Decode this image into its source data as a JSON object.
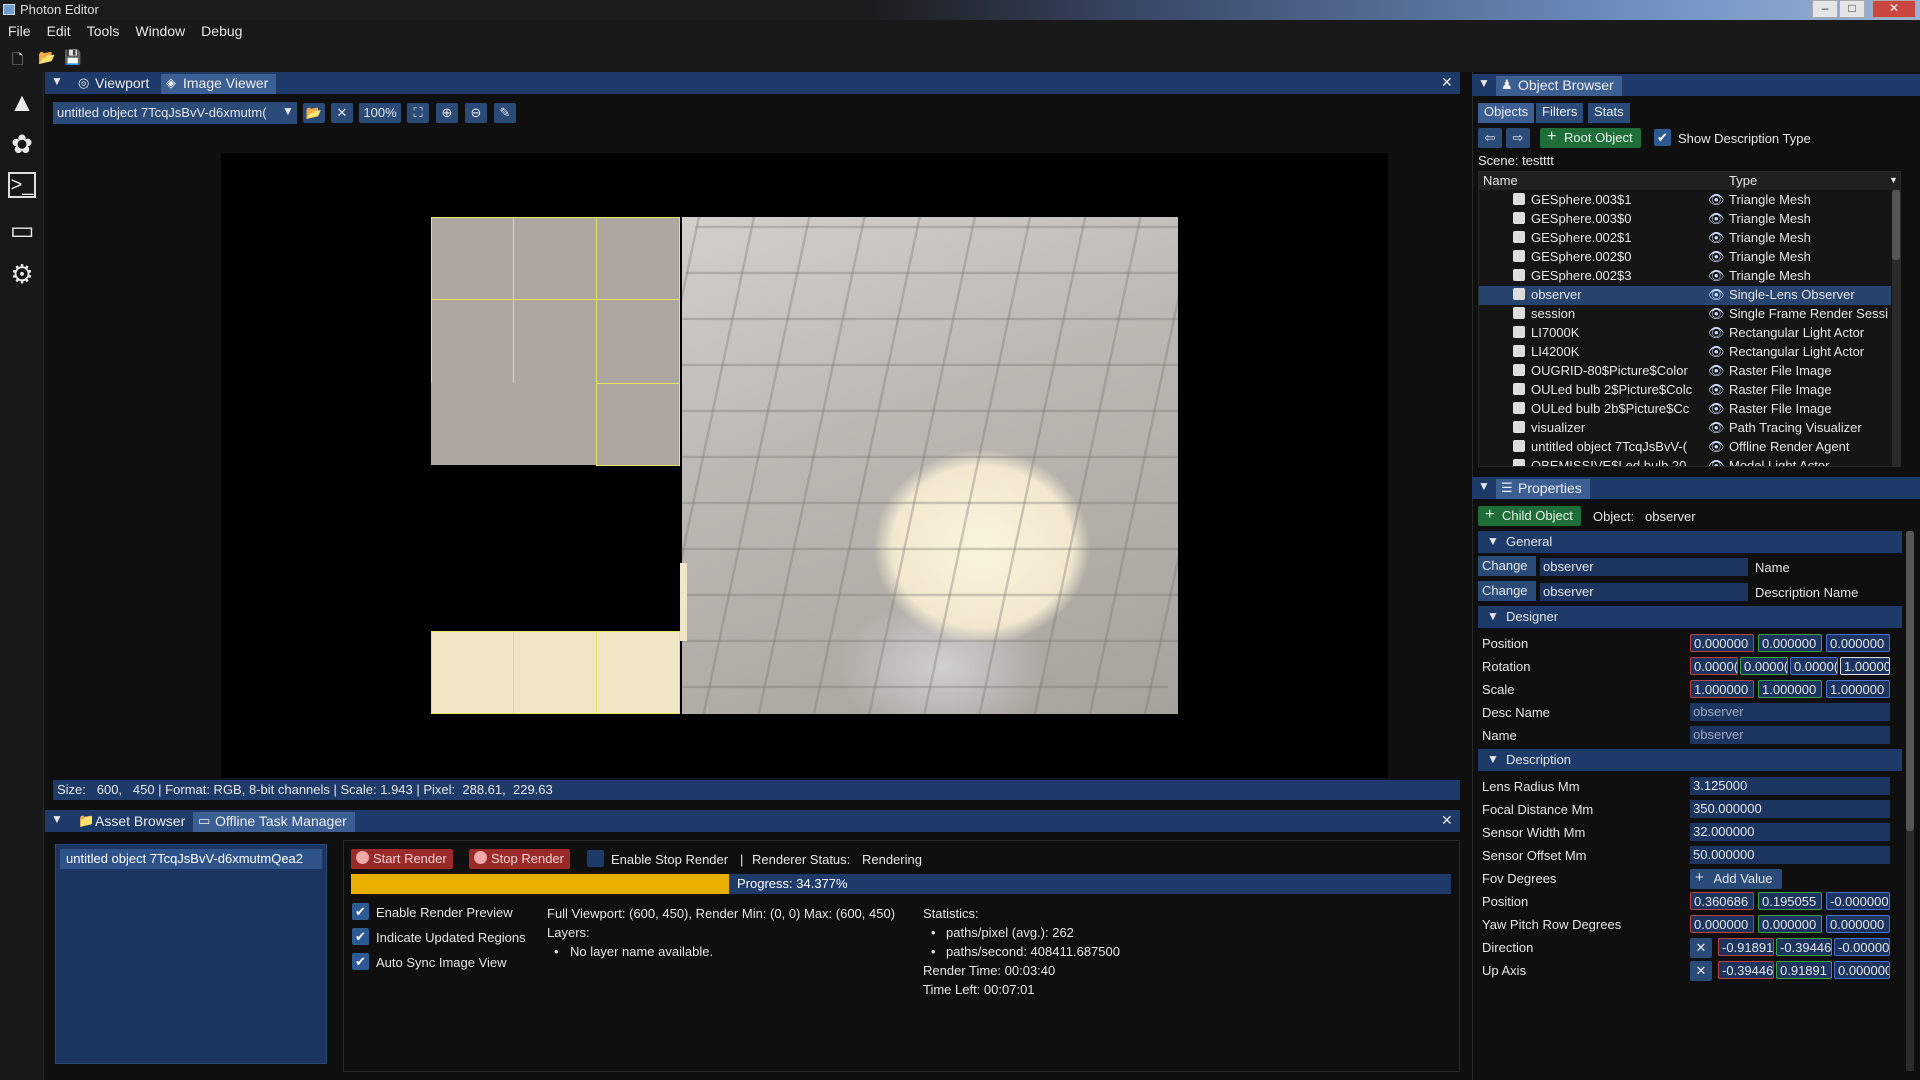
{
  "window": {
    "title": "Photon Editor",
    "minimize": "–",
    "maximize": "□",
    "close": "✕"
  },
  "menu": [
    "File",
    "Edit",
    "Tools",
    "Window",
    "Debug"
  ],
  "toolbar_icons": [
    "new-file-icon",
    "open-folder-icon",
    "save-icon"
  ],
  "left_sidebar_icons": [
    "tree-icon",
    "gear-flower-icon",
    "terminal-icon",
    "monitor-icon",
    "settings-icon"
  ],
  "viewport_panel": {
    "tabs": [
      {
        "label": "Viewport",
        "icon": "globe-icon"
      },
      {
        "label": "Image Viewer",
        "icon": "image-icon",
        "active": true
      }
    ],
    "image_select": "untitled object 7TcqJsBvV-d6xmutm(",
    "zoom": "100%",
    "status": "Size:   600,   450 | Format: RGB, 8-bit channels | Scale: 1.943 | Pixel:  288.61,  229.63"
  },
  "bottom_panel": {
    "tabs": [
      {
        "label": "Asset Browser",
        "icon": "folder-icon"
      },
      {
        "label": "Offline Task Manager",
        "icon": "monitor-icon",
        "active": true
      }
    ],
    "asset_item": "untitled object 7TcqJsBvV-d6xmutmQea2",
    "start_render": "Start Render",
    "stop_render": "Stop Render",
    "enable_stop_render": "Enable Stop Render",
    "separator": "|",
    "renderer_status_label": "Renderer Status:",
    "renderer_status": "Rendering",
    "progress_fraction": 0.34377,
    "progress_text": "Progress: 34.377%",
    "checkboxes": [
      {
        "label": "Enable Render Preview",
        "checked": true
      },
      {
        "label": "Indicate Updated Regions",
        "checked": true
      },
      {
        "label": "Auto Sync Image View",
        "checked": true
      }
    ],
    "viewport_info": "Full Viewport: (600, 450), Render Min: (0, 0) Max: (600, 450)",
    "layers_label": "Layers:",
    "layers_item": "No layer name available.",
    "statistics_label": "Statistics:",
    "stats": [
      "paths/pixel (avg.): 262",
      "paths/second: 408411.687500"
    ],
    "render_time": "Render Time: 00:03:40",
    "time_left": "Time Left: 00:07:01"
  },
  "object_browser": {
    "title": "Object Browser",
    "subtabs": [
      "Objects",
      "Filters",
      "Stats"
    ],
    "root_object": "Root Object",
    "show_description_type": "Show Description Type",
    "scene": "Scene: testttt",
    "columns": [
      "Name",
      "Type"
    ],
    "rows": [
      {
        "name": "GESphere.003$1",
        "type": "Triangle Mesh"
      },
      {
        "name": "GESphere.003$0",
        "type": "Triangle Mesh"
      },
      {
        "name": "GESphere.002$1",
        "type": "Triangle Mesh"
      },
      {
        "name": "GESphere.002$0",
        "type": "Triangle Mesh"
      },
      {
        "name": "GESphere.002$3",
        "type": "Triangle Mesh"
      },
      {
        "name": "observer",
        "type": "Single-Lens Observer",
        "selected": true
      },
      {
        "name": "session",
        "type": "Single Frame Render Sessi"
      },
      {
        "name": "LI7000K",
        "type": "Rectangular Light Actor"
      },
      {
        "name": "LI4200K",
        "type": "Rectangular Light Actor"
      },
      {
        "name": "OUGRID-80$Picture$Color",
        "type": "Raster File Image"
      },
      {
        "name": "OULed bulb 2$Picture$Colc",
        "type": "Raster File Image"
      },
      {
        "name": "OULed bulb 2b$Picture$Cc",
        "type": "Raster File Image"
      },
      {
        "name": "visualizer",
        "type": "Path Tracing Visualizer"
      },
      {
        "name": "untitled object 7TcqJsBvV-(",
        "type": "Offline Render Agent"
      },
      {
        "name": "OBEMISSIVE$Led bulb 20",
        "type": "Model Light Actor"
      }
    ]
  },
  "properties": {
    "title": "Properties",
    "child_object": "Child Object",
    "object_label": "Object:",
    "object_name": "observer",
    "general_header": "General",
    "general": [
      {
        "button": "Change",
        "value": "observer",
        "label": "Name"
      },
      {
        "button": "Change",
        "value": "observer",
        "label": "Description Name"
      }
    ],
    "designer_header": "Designer",
    "designer": {
      "position": {
        "label": "Position",
        "x": "0.000000",
        "y": "0.000000",
        "z": "0.000000"
      },
      "rotation": {
        "label": "Rotation",
        "x": "0.0000(",
        "y": "0.0000(",
        "z": "0.0000(",
        "w": "1.00000"
      },
      "scale": {
        "label": "Scale",
        "x": "1.000000",
        "y": "1.000000",
        "z": "1.000000"
      },
      "desc_name": {
        "label": "Desc Name",
        "value": "observer"
      },
      "name": {
        "label": "Name",
        "value": "observer"
      }
    },
    "description_header": "Description",
    "description": {
      "lens_radius": {
        "label": "Lens Radius Mm",
        "value": "3.125000"
      },
      "focal_distance": {
        "label": "Focal Distance Mm",
        "value": "350.000000"
      },
      "sensor_width": {
        "label": "Sensor Width Mm",
        "value": "32.000000"
      },
      "sensor_offset": {
        "label": "Sensor Offset Mm",
        "value": "50.000000"
      },
      "fov": {
        "label": "Fov Degrees",
        "button": "Add Value"
      },
      "position": {
        "label": "Position",
        "x": "0.360686",
        "y": "0.195055",
        "z": "-0.000000"
      },
      "yaw_pitch_row": {
        "label": "Yaw Pitch Row Degrees",
        "x": "0.000000",
        "y": "0.000000",
        "z": "0.000000"
      },
      "direction": {
        "label": "Direction",
        "x": "-0.91891",
        "y": "-0.39446",
        "z": "-0.00000"
      },
      "up_axis": {
        "label": "Up Axis",
        "x": "-0.39446",
        "y": "0.91891",
        "z": "0.000000"
      }
    }
  },
  "colors": {
    "accent": "#1d3a68",
    "tab_active": "#3c5f93",
    "progress": "#e9b000",
    "tile_border": "#e5e45e",
    "red_button": "#9b2a2a",
    "green_button": "#1f6e3a"
  }
}
